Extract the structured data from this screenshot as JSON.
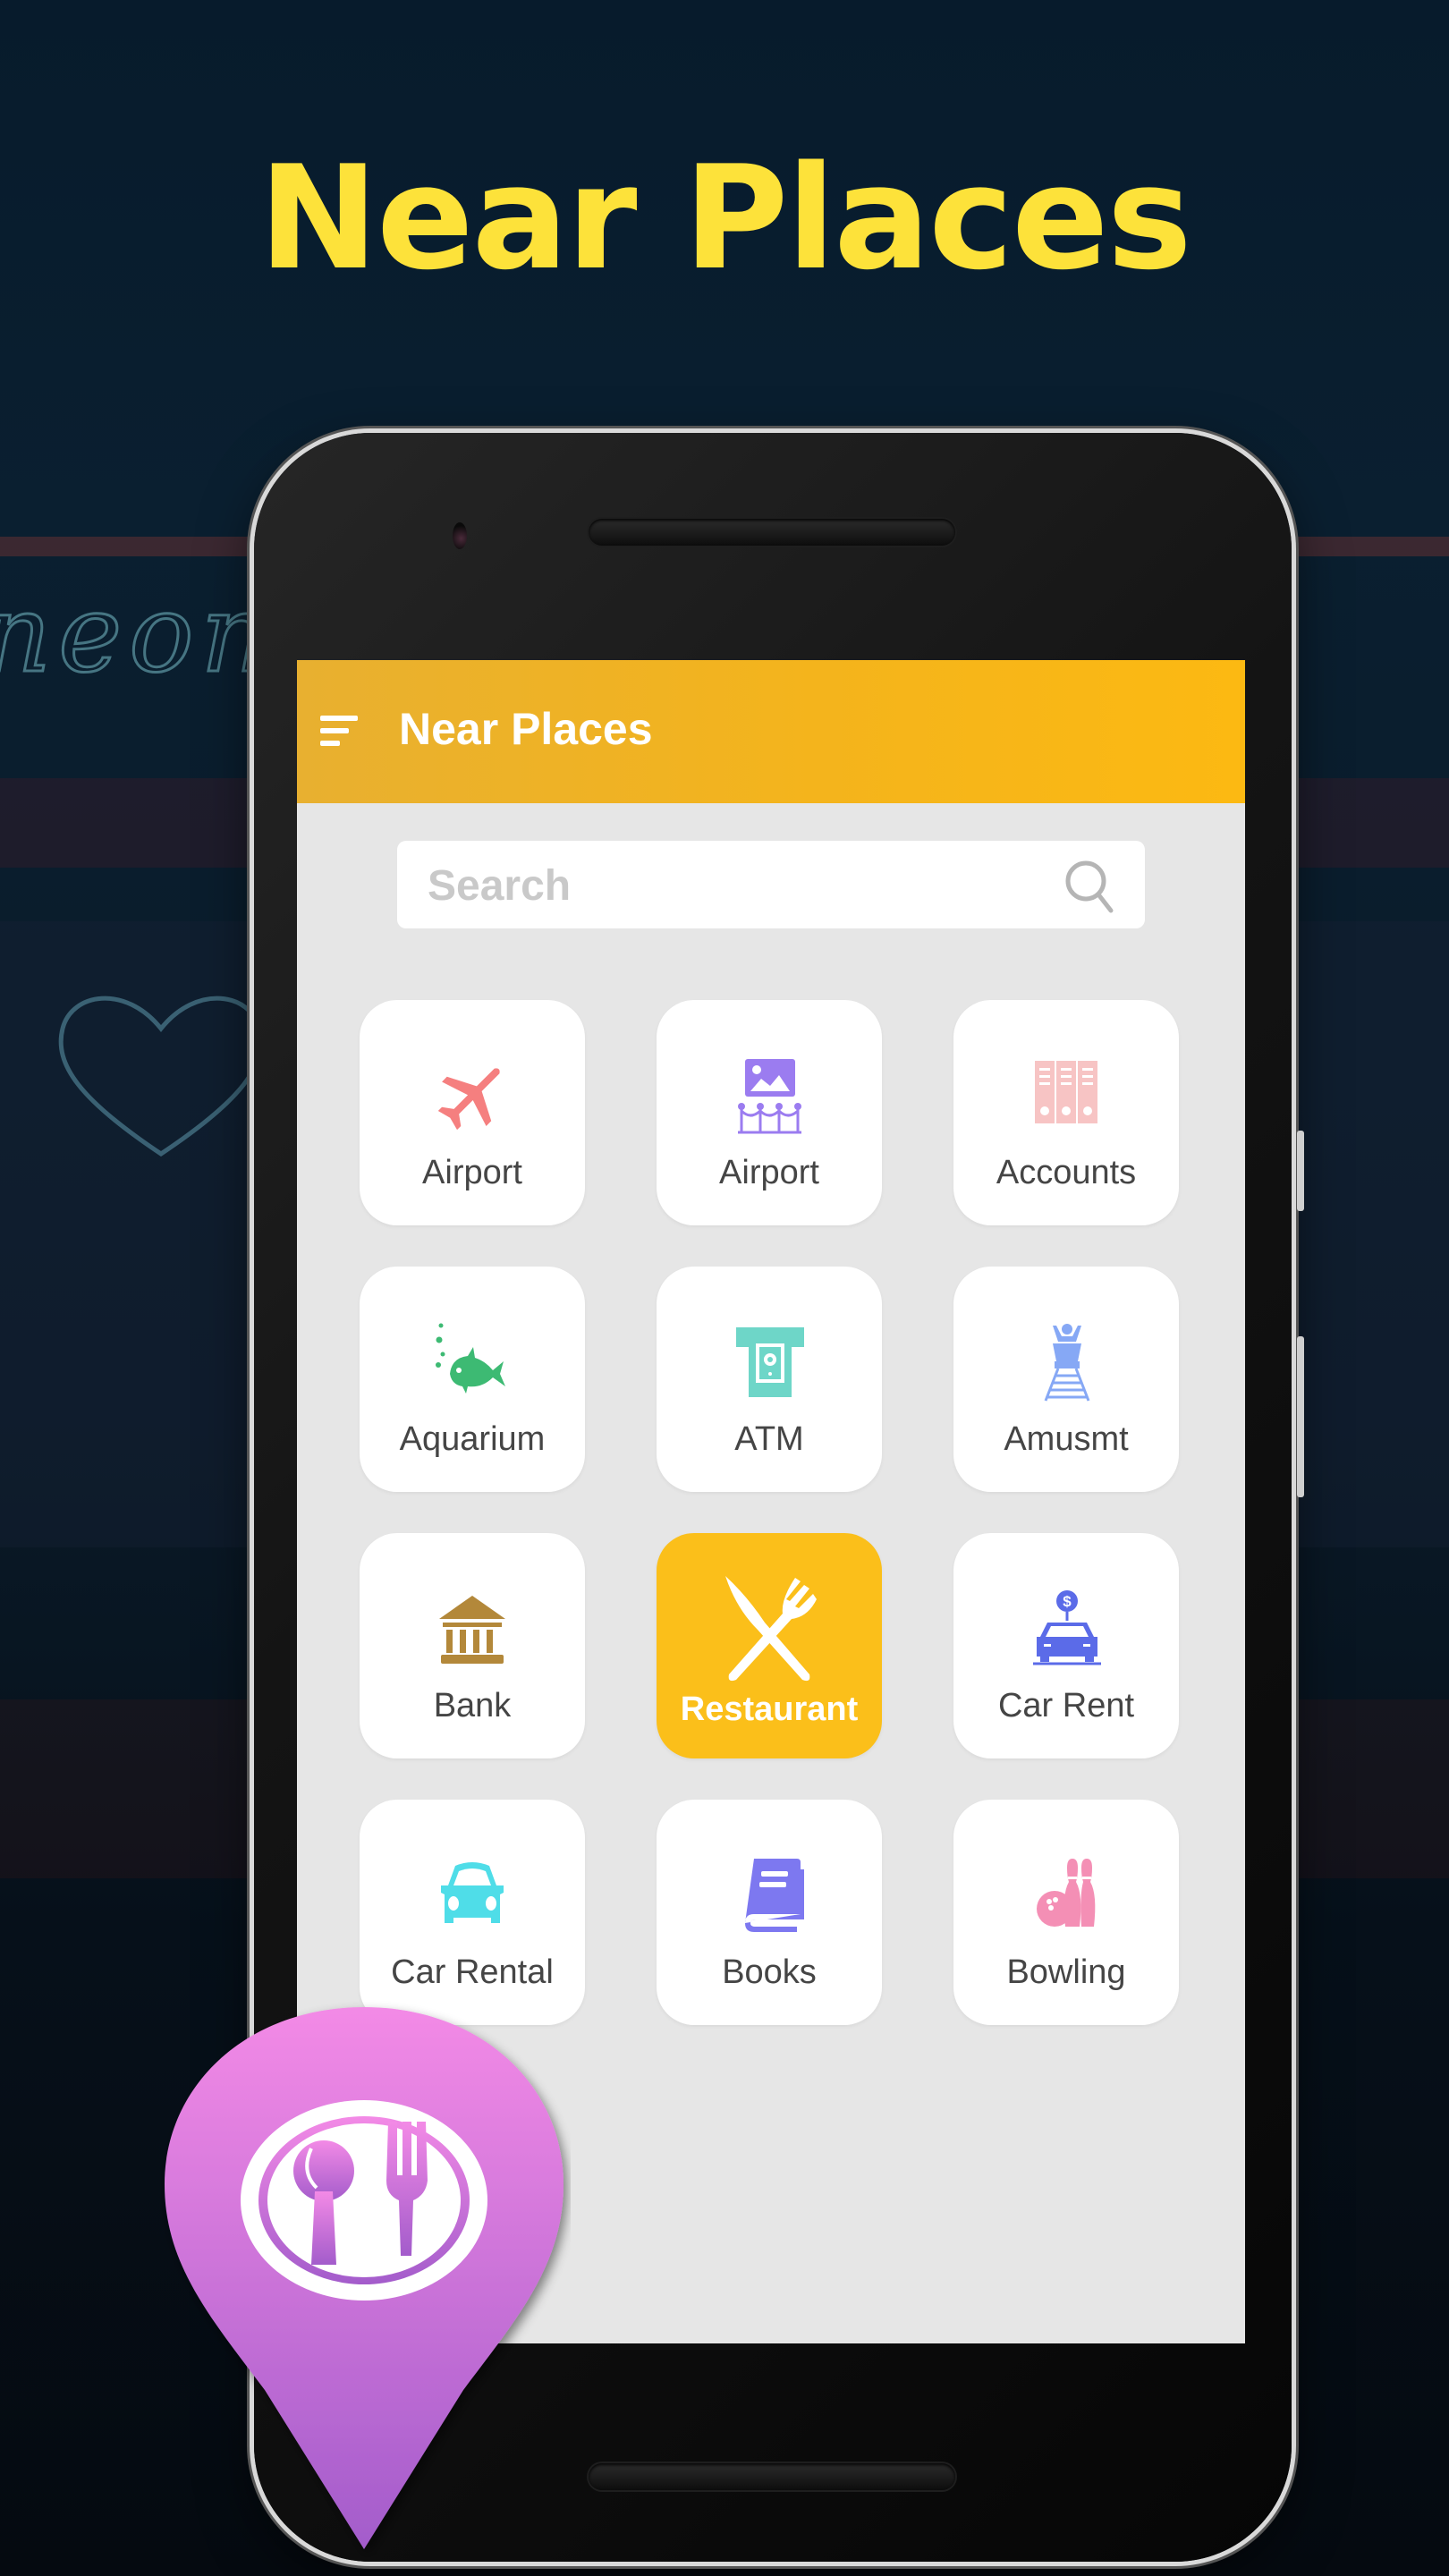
{
  "headline": "Near Places",
  "app": {
    "title": "Near Places",
    "menu_icon": "hamburger-menu-icon",
    "accent_color": "#fbbf1a",
    "search": {
      "placeholder": "Search",
      "value": "",
      "icon": "search-icon"
    }
  },
  "categories": [
    {
      "label": "Airport",
      "icon": "airplane-icon",
      "color": "#f57f7f",
      "selected": false
    },
    {
      "label": "Airport",
      "icon": "art-gallery-icon",
      "color": "#9b7cf0",
      "selected": false
    },
    {
      "label": "Accounts",
      "icon": "binders-icon",
      "color": "#f7c4c4",
      "selected": false
    },
    {
      "label": "Aquarium",
      "icon": "fish-icon",
      "color": "#3dba73",
      "selected": false
    },
    {
      "label": "ATM",
      "icon": "atm-cash-icon",
      "color": "#6ed6c8",
      "selected": false
    },
    {
      "label": "Amusmt",
      "icon": "roller-coaster-icon",
      "color": "#86a8f5",
      "selected": false
    },
    {
      "label": "Bank",
      "icon": "bank-icon",
      "color": "#b3883a",
      "selected": false
    },
    {
      "label": "Restaurant",
      "icon": "knife-fork-icon",
      "color": "#ffffff",
      "selected": true
    },
    {
      "label": "Car Rent",
      "icon": "car-rent-dollar-icon",
      "color": "#5b6be8",
      "selected": false
    },
    {
      "label": "Car Rental",
      "icon": "car-icon",
      "color": "#4fdde8",
      "selected": false
    },
    {
      "label": "Books",
      "icon": "book-icon",
      "color": "#7d78f0",
      "selected": false
    },
    {
      "label": "Bowling",
      "icon": "bowling-icon",
      "color": "#f48fb5",
      "selected": false
    }
  ],
  "badge": {
    "icon": "restaurant-location-pin-icon",
    "gradient_top": "#f38ae6",
    "gradient_bottom": "#a35ccb"
  }
}
